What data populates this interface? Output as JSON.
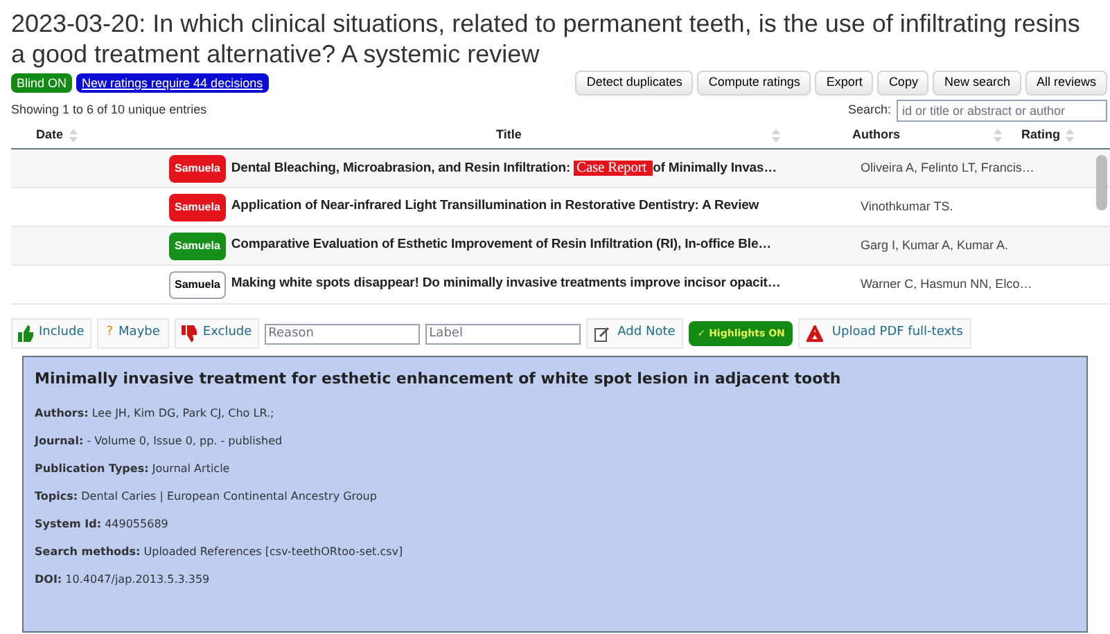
{
  "review": {
    "title": "2023-03-20: In which clinical situations, related to permanent teeth, is the use of infiltrating resins a good treatment alternative? A systemic review",
    "blind_badge": "Blind ON",
    "ratings_link": "New ratings require 44 decisions"
  },
  "actions": [
    "Detect duplicates",
    "Compute ratings",
    "Export",
    "Copy",
    "New search",
    "All reviews"
  ],
  "entries_info": "Showing 1 to 6 of 10 unique entries",
  "search": {
    "label": "Search:",
    "placeholder": "id or title or abstract or author"
  },
  "table": {
    "columns": [
      "Date",
      "Title",
      "Authors",
      "Rating"
    ],
    "rows": [
      {
        "reviewer": "Samuela",
        "color": "#e3141b",
        "title": [
          {
            "text": "Dental Bleaching, Microabrasion, and Resin Infiltration: ",
            "highlight": false
          },
          {
            "text": "Case Report ",
            "highlight": true
          },
          {
            "text": "of Minimally Invas…",
            "highlight": false
          }
        ],
        "authors": "Oliveira A, Felinto LT, Francis…",
        "selected": false
      },
      {
        "reviewer": "Samuela",
        "color": "#e3141b",
        "title": [
          {
            "text": "Application of Near-infrared Light Transillumination in Restorative Dentistry: A Review",
            "highlight": false
          }
        ],
        "authors": "Vinothkumar TS.",
        "selected": false
      },
      {
        "reviewer": "Samuela",
        "color": "#16901b",
        "title": [
          {
            "text": "Comparative Evaluation of Esthetic Improvement of Resin Infiltration (RI), In-office Ble…",
            "highlight": false
          }
        ],
        "authors": "Garg I, Kumar A, Kumar A.",
        "selected": false
      },
      {
        "reviewer": "Samuela",
        "color": "#ffffff",
        "title": [
          {
            "text": "Making white spots disappear! Do minimally invasive treatments improve incisor opacit…",
            "highlight": false
          }
        ],
        "authors": "Warner C, Hasmun NN, Elco…",
        "selected": false
      }
    ]
  },
  "toolbar": {
    "include": "Include",
    "maybe": "Maybe",
    "maybe_icon": "?",
    "exclude": "Exclude",
    "reason_placeholder": "Reason",
    "label_placeholder": "Label",
    "add_note": "Add Note",
    "highlights": {
      "check": "✓",
      "label": "Highlights ON",
      "on": true
    },
    "upload": "Upload PDF full-texts"
  },
  "detail": {
    "title": "Minimally invasive treatment for esthetic enhancement of white spot lesion in adjacent tooth",
    "fields": [
      {
        "label": "Authors:",
        "value": "Lee JH, Kim DG, Park CJ, Cho LR.;"
      },
      {
        "label": "Journal:",
        "value": "- Volume 0, Issue 0, pp. - published"
      },
      {
        "label": "Publication Types:",
        "value": "Journal Article"
      },
      {
        "label": "Topics:",
        "value": "Dental Caries | European Continental Ancestry Group"
      },
      {
        "label": "System Id:",
        "value": "449055689"
      },
      {
        "label": "Search methods:",
        "value": "Uploaded References [csv-teethORtoo-set.csv]"
      },
      {
        "label": "DOI:",
        "value": "10.4047/jap.2013.5.3.359"
      }
    ]
  }
}
